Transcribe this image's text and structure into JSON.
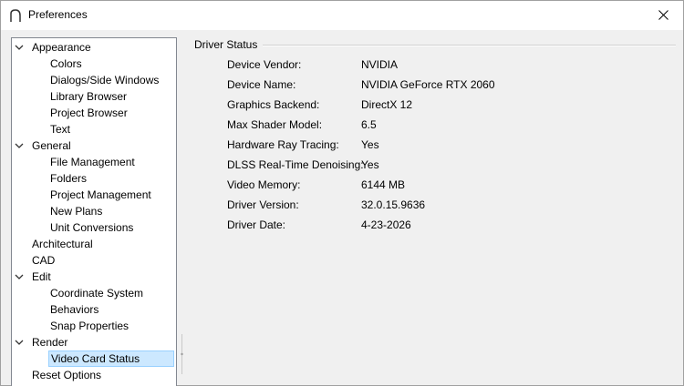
{
  "window": {
    "title": "Preferences"
  },
  "tree": [
    {
      "label": "Appearance",
      "level": 0,
      "expandable": true
    },
    {
      "label": "Colors",
      "level": 1
    },
    {
      "label": "Dialogs/Side Windows",
      "level": 1
    },
    {
      "label": "Library Browser",
      "level": 1
    },
    {
      "label": "Project Browser",
      "level": 1
    },
    {
      "label": "Text",
      "level": 1
    },
    {
      "label": "General",
      "level": 0,
      "expandable": true
    },
    {
      "label": "File Management",
      "level": 1
    },
    {
      "label": "Folders",
      "level": 1
    },
    {
      "label": "Project Management",
      "level": 1
    },
    {
      "label": "New Plans",
      "level": 1
    },
    {
      "label": "Unit Conversions",
      "level": 1
    },
    {
      "label": "Architectural",
      "level": 0
    },
    {
      "label": "CAD",
      "level": 0
    },
    {
      "label": "Edit",
      "level": 0,
      "expandable": true
    },
    {
      "label": "Coordinate System",
      "level": 1
    },
    {
      "label": "Behaviors",
      "level": 1
    },
    {
      "label": "Snap Properties",
      "level": 1
    },
    {
      "label": "Render",
      "level": 0,
      "expandable": true
    },
    {
      "label": "Video Card Status",
      "level": 1,
      "selected": true
    },
    {
      "label": "Reset Options",
      "level": 0
    }
  ],
  "panel": {
    "section_title": "Driver Status",
    "rows": [
      {
        "key": "Device Vendor:",
        "value": "NVIDIA"
      },
      {
        "key": "Device Name:",
        "value": "NVIDIA GeForce RTX 2060"
      },
      {
        "key": "Graphics Backend:",
        "value": "DirectX 12"
      },
      {
        "key": "Max Shader Model:",
        "value": "6.5"
      },
      {
        "key": "Hardware Ray Tracing:",
        "value": "Yes"
      },
      {
        "key": "DLSS Real-Time Denoising:",
        "value": "Yes"
      },
      {
        "key": "Video Memory:",
        "value": "6144 MB"
      },
      {
        "key": "Driver Version:",
        "value": "32.0.15.9636"
      },
      {
        "key": "Driver Date:",
        "value": "4-23-2026"
      }
    ]
  }
}
